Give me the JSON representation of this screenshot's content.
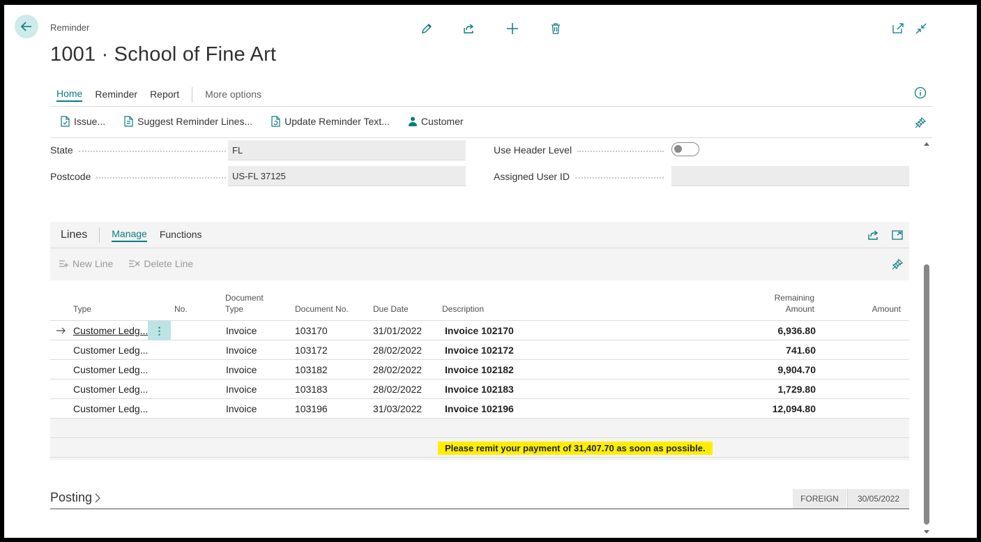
{
  "header": {
    "caption": "Reminder",
    "title": "1001 · School of Fine Art"
  },
  "tabs": [
    {
      "label": "Home",
      "active": true
    },
    {
      "label": "Reminder"
    },
    {
      "label": "Report"
    }
  ],
  "more_options": "More options",
  "actions": [
    {
      "label": "Issue...",
      "icon": "issue-document-icon"
    },
    {
      "label": "Suggest Reminder Lines...",
      "icon": "suggest-lines-icon"
    },
    {
      "label": "Update Reminder Text...",
      "icon": "update-text-icon"
    },
    {
      "label": "Customer",
      "icon": "person-icon"
    }
  ],
  "fields": {
    "state_label": "State",
    "state_value": "FL",
    "postcode_label": "Postcode",
    "postcode_value": "US-FL 37125",
    "header_level_label": "Use Header Level",
    "header_level_value": false,
    "assigned_user_label": "Assigned User ID",
    "assigned_user_value": ""
  },
  "lines": {
    "title": "Lines",
    "tabs": [
      "Manage",
      "Functions"
    ],
    "new_line": "New Line",
    "delete_line": "Delete Line",
    "columns": {
      "type": "Type",
      "no": "No.",
      "doc_type_1": "Document",
      "doc_type_2": "Type",
      "doc_no": "Document No.",
      "due_date": "Due Date",
      "description": "Description",
      "remaining_1": "Remaining",
      "remaining_2": "Amount",
      "amount": "Amount"
    },
    "rows": [
      {
        "type": "Customer Ledg...",
        "doc_type": "Invoice",
        "doc_no": "103170",
        "due_date": "31/01/2022",
        "description": "Invoice 102170",
        "remaining": "6,936.80"
      },
      {
        "type": "Customer Ledg...",
        "doc_type": "Invoice",
        "doc_no": "103172",
        "due_date": "28/02/2022",
        "description": "Invoice 102172",
        "remaining": "741.60"
      },
      {
        "type": "Customer Ledg...",
        "doc_type": "Invoice",
        "doc_no": "103182",
        "due_date": "28/02/2022",
        "description": "Invoice 102182",
        "remaining": "9,904.70"
      },
      {
        "type": "Customer Ledg...",
        "doc_type": "Invoice",
        "doc_no": "103183",
        "due_date": "28/02/2022",
        "description": "Invoice 102183",
        "remaining": "1,729.80"
      },
      {
        "type": "Customer Ledg...",
        "doc_type": "Invoice",
        "doc_no": "103196",
        "due_date": "31/03/2022",
        "description": "Invoice 102196",
        "remaining": "12,094.80"
      }
    ],
    "ending_text": "Please remit your payment of 31,407.70 as soon as possible."
  },
  "posting": {
    "title": "Posting",
    "badge1": "FOREIGN",
    "badge2": "30/05/2022"
  },
  "colors": {
    "accent": "#0a7c80",
    "highlight": "#ffee00"
  }
}
